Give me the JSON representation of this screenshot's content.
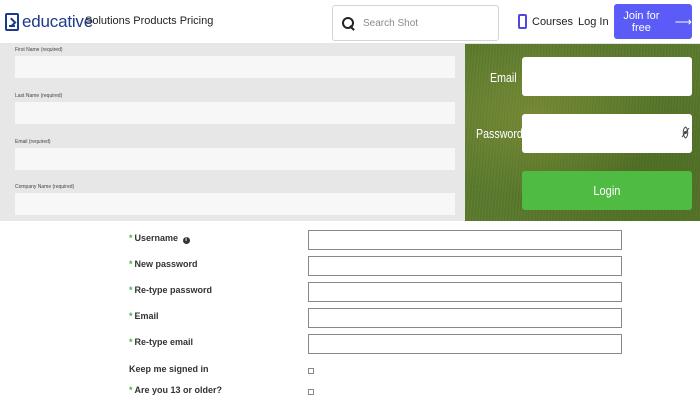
{
  "header": {
    "logo_text": "educative",
    "nav": [
      "Solutions",
      "Products",
      "Pricing"
    ],
    "search_placeholder": "Search Shot",
    "courses_label": "Courses",
    "login_label": "Log In",
    "join_label": "Join for free",
    "join_arrow": "⟶",
    "accent_color": "#5b5bf7"
  },
  "grey_form": {
    "fields": [
      {
        "label": "First Name (required)"
      },
      {
        "label": "Last Name (required)"
      },
      {
        "label": "Email (required)"
      },
      {
        "label": "Company Name (required)"
      }
    ]
  },
  "login_panel": {
    "email_label": "Email",
    "password_label": "Password",
    "login_button": "Login",
    "button_color": "#4fbb42",
    "eye_icon": "eye-slash-icon"
  },
  "register": {
    "required_mark": "*",
    "info_glyph": "i",
    "fields": [
      {
        "label": "Username",
        "required": true,
        "info": true
      },
      {
        "label": "New password",
        "required": true
      },
      {
        "label": "Re-type password",
        "required": true
      },
      {
        "label": "Email",
        "required": true
      },
      {
        "label": "Re-type email",
        "required": true
      }
    ],
    "checkboxes": [
      {
        "label": "Keep me signed in",
        "required": false,
        "checked": false
      },
      {
        "label": "Are you 13 or older?",
        "required": true,
        "checked": false
      }
    ]
  }
}
